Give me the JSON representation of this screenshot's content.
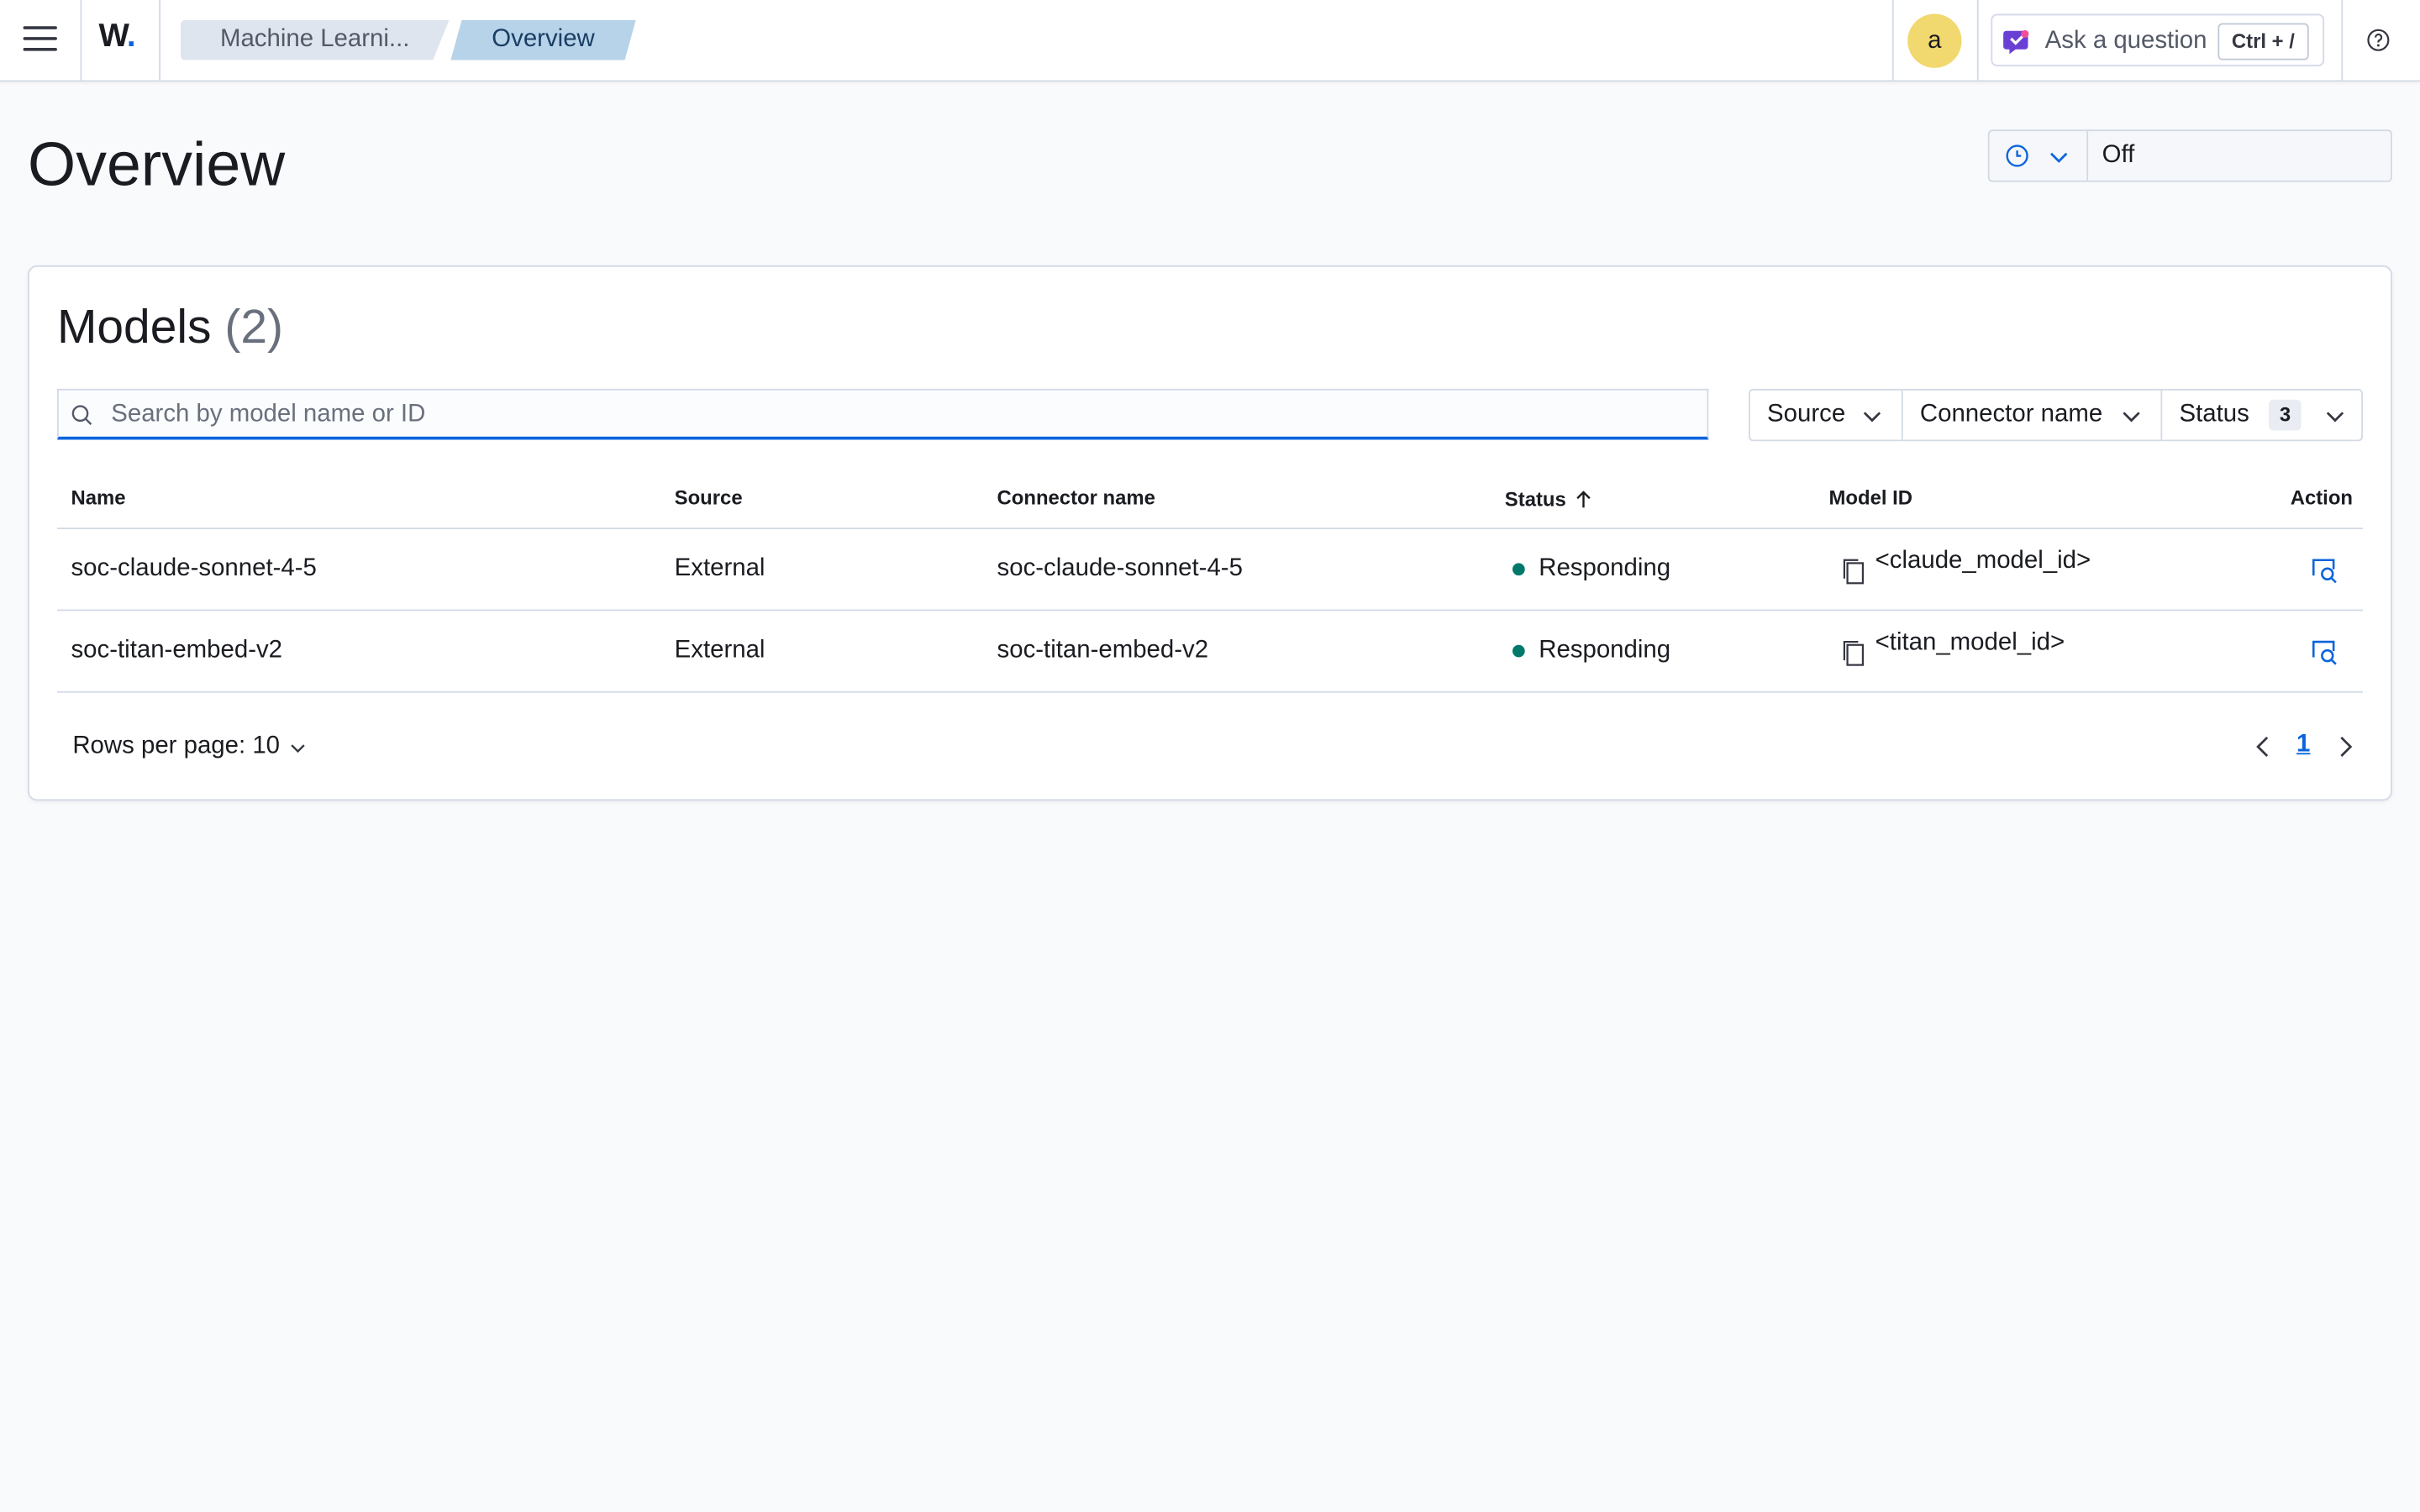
{
  "header": {
    "logo_letter": "W",
    "logo_dot": ".",
    "breadcrumbs": [
      "Machine Learni...",
      "Overview"
    ],
    "avatar_initial": "a",
    "ask_label": "Ask a question",
    "ask_shortcut": "Ctrl + /"
  },
  "page": {
    "title": "Overview",
    "refresh_value": "Off"
  },
  "models": {
    "title": "Models",
    "count": "(2)",
    "search_placeholder": "Search by model name or ID",
    "filters": {
      "source": "Source",
      "connector": "Connector name",
      "status": "Status",
      "status_count": "3"
    },
    "columns": {
      "name": "Name",
      "source": "Source",
      "connector": "Connector name",
      "status": "Status",
      "model_id": "Model ID",
      "action": "Action"
    },
    "rows": [
      {
        "name": "soc-claude-sonnet-4-5",
        "source": "External",
        "connector": "soc-claude-sonnet-4-5",
        "status": "Responding",
        "model_id": "<claude_model_id>"
      },
      {
        "name": "soc-titan-embed-v2",
        "source": "External",
        "connector": "soc-titan-embed-v2",
        "status": "Responding",
        "model_id": "<titan_model_id>"
      }
    ],
    "rows_per_page": "Rows per page: 10",
    "current_page": "1"
  },
  "colors": {
    "accent": "#0b64dd",
    "status_ok": "#00796b",
    "avatar": "#f1d86f"
  },
  "icons": [
    "menu-icon",
    "clock-icon",
    "chevron-down-icon",
    "search-icon",
    "copy-icon",
    "inspect-icon",
    "help-icon",
    "chevron-left-icon",
    "chevron-right-icon",
    "sort-ascending-icon",
    "assistant-icon"
  ]
}
